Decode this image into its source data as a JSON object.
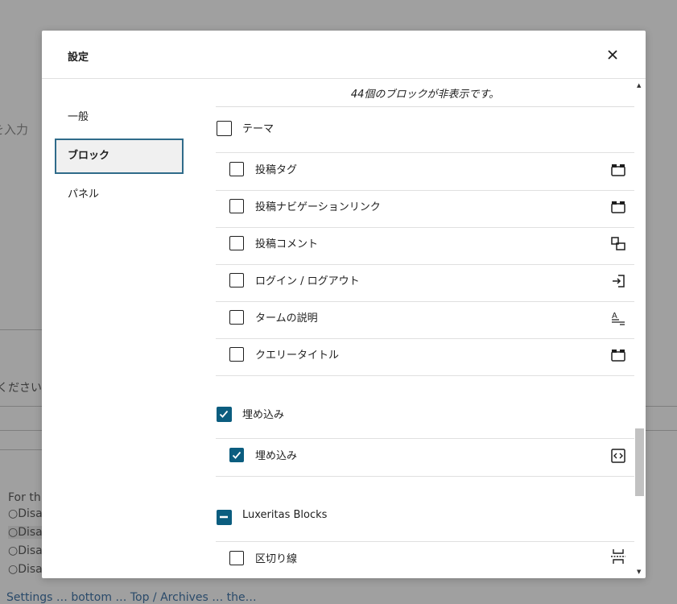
{
  "background": {
    "fragment_input": "を入力",
    "fragment_please": "ください。",
    "fragment_for_this": "For this",
    "fragment_disable": "Disab",
    "fragment_bottom": "Settings … bottom … Top / Archives … the…"
  },
  "modal": {
    "title": "設定",
    "close_icon": "close-icon"
  },
  "sidebar": {
    "items": [
      {
        "label": "一般",
        "active": false
      },
      {
        "label": "ブロック",
        "active": true
      },
      {
        "label": "パネル",
        "active": false
      }
    ]
  },
  "blocks": {
    "hidden_count_text": "44個のブロックが非表示です。",
    "categories": [
      {
        "name": "テーマ",
        "state": "unchecked",
        "items": [
          {
            "label": "投稿タグ",
            "checked": false,
            "icon": "block-default-icon"
          },
          {
            "label": "投稿ナビゲーションリンク",
            "checked": false,
            "icon": "block-default-icon"
          },
          {
            "label": "投稿コメント",
            "checked": false,
            "icon": "comments-icon"
          },
          {
            "label": "ログイン / ログアウト",
            "checked": false,
            "icon": "login-icon"
          },
          {
            "label": "タームの説明",
            "checked": false,
            "icon": "term-description-icon"
          },
          {
            "label": "クエリータイトル",
            "checked": false,
            "icon": "block-default-icon"
          }
        ]
      },
      {
        "name": "埋め込み",
        "state": "checked",
        "items": [
          {
            "label": "埋め込み",
            "checked": true,
            "icon": "embed-icon"
          }
        ]
      },
      {
        "name": "Luxeritas Blocks",
        "state": "mixed",
        "items": [
          {
            "label": "区切り線",
            "checked": false,
            "icon": "separator-icon"
          }
        ]
      }
    ]
  },
  "colors": {
    "accent": "#0b5d7f",
    "active_border": "#2f6b8a",
    "overlay_bg": "#a0a0a0"
  }
}
